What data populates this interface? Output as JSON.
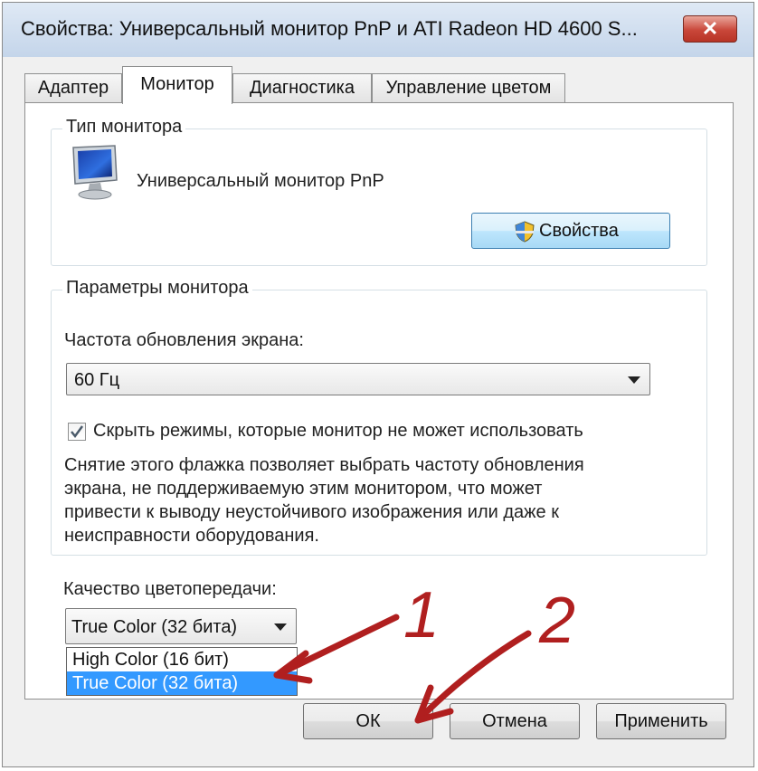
{
  "window": {
    "title": "Свойства: Универсальный монитор PnP и ATI Radeon HD 4600 S...",
    "close_label": "✕"
  },
  "tabs": [
    {
      "label": "Адаптер",
      "active": false
    },
    {
      "label": "Монитор",
      "active": true
    },
    {
      "label": "Диагностика",
      "active": false
    },
    {
      "label": "Управление цветом",
      "active": false
    }
  ],
  "monitor_type": {
    "group_label": "Тип монитора",
    "monitor_name": "Универсальный монитор PnP",
    "properties_button": "Свойства"
  },
  "monitor_settings": {
    "group_label": "Параметры монитора",
    "refresh_label": "Частота обновления экрана:",
    "refresh_value": "60 Гц",
    "hide_modes_label": "Скрыть режимы, которые монитор не может использовать",
    "hide_modes_checked": true,
    "description": [
      "Снятие этого флажка позволяет выбрать частоту обновления",
      "экрана, не поддерживаемую этим монитором, что может",
      "привести к выводу неустойчивого изображения или даже к",
      "неисправности оборудования."
    ]
  },
  "color_quality": {
    "label": "Качество цветопередачи:",
    "selected_value": "True Color (32 бита)",
    "options": [
      "High Color (16 бит)",
      "True Color (32 бита)"
    ],
    "highlighted_index": 1
  },
  "annotations": {
    "marker_1": "1",
    "marker_2": "2",
    "arrow_color": "#b01f1f"
  },
  "buttons": {
    "ok": "ОК",
    "cancel": "Отмена",
    "apply": "Применить"
  }
}
